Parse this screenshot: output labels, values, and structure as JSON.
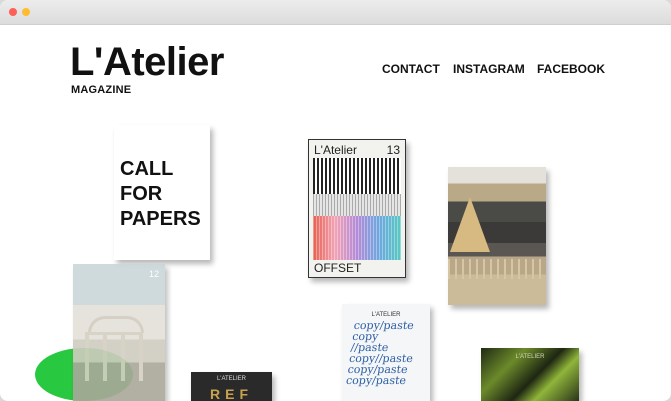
{
  "window": {
    "title": ""
  },
  "header": {
    "logo": "L'Atelier",
    "logo_sub": "MAGAZINE",
    "nav": [
      "CONTACT",
      "INSTAGRAM",
      "FACEBOOK"
    ]
  },
  "cards": {
    "cfp_lines": [
      "CALL",
      "FOR",
      "PAPERS"
    ],
    "mag13": {
      "brand": "L'Atelier",
      "number": "13",
      "title": "OFFSET"
    },
    "house": {
      "number": "12"
    },
    "ref": {
      "brand": "L'ATELIER",
      "title": "REF"
    },
    "copy": {
      "brand": "L'ATELIER",
      "text": [
        "copy/paste",
        "copy",
        "//paste",
        "copy//paste",
        "copy/paste",
        "copy/paste"
      ]
    },
    "green": {
      "brand": "L'ATELIER"
    }
  }
}
